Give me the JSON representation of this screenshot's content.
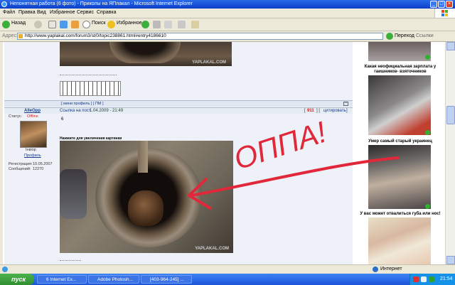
{
  "window": {
    "title": "Непонятная работа (6 фото) - Приколы на ЯПлакал - Microsoft Internet Explorer"
  },
  "menu": [
    "Файл",
    "Правка",
    "Вид",
    "Избранное",
    "Сервис",
    "Справка"
  ],
  "toolbar": {
    "back": "Назад",
    "search": "Поиск",
    "favorites": "Избранное"
  },
  "address": {
    "label": "Адрес:",
    "url": "http://www.yaplakal.com/forum3/st/0/topic238861.html#entry4186610",
    "go": "Переход",
    "links": "Ссылки"
  },
  "post1": {
    "profile": "[ мини профиль ] [ ПМ ]"
  },
  "post2": {
    "author": "AlleOpp",
    "status_label": "Статус:",
    "status_value": "Offline",
    "rank": "Інвіор",
    "profile_link": "Профиль",
    "reg_label": "Регистрация:",
    "reg_date": "10.05.2007",
    "msgs_label": "Сообщений:",
    "msgs": "12270",
    "link": "Ссылка на пост",
    "date": "1.04.2009 - 21:49",
    "number": "6",
    "click_hint": "Нажмите для увеличения картинки",
    "rating": "911",
    "quote": "цитировать",
    "watermark": "YAPLAKAL.COM"
  },
  "annotation": {
    "text": "ОППА!"
  },
  "sidebar": {
    "captions": [
      "Какая неофициальная зарплата у гаишников- взяточников",
      "Умер самый старый украинец",
      "У вас может отвалиться губа или нос!"
    ]
  },
  "status": {
    "zone": "Интернет"
  },
  "taskbar": {
    "start": "пуск",
    "tasks": [
      "6 Internet Ex...",
      "Adobe Photosh...",
      "[403-964-245] ..."
    ],
    "clock": "21:54"
  },
  "colors": {
    "titlebar": "#0a3fc8",
    "annotation": "#e0283a",
    "offline": "#e02020"
  }
}
